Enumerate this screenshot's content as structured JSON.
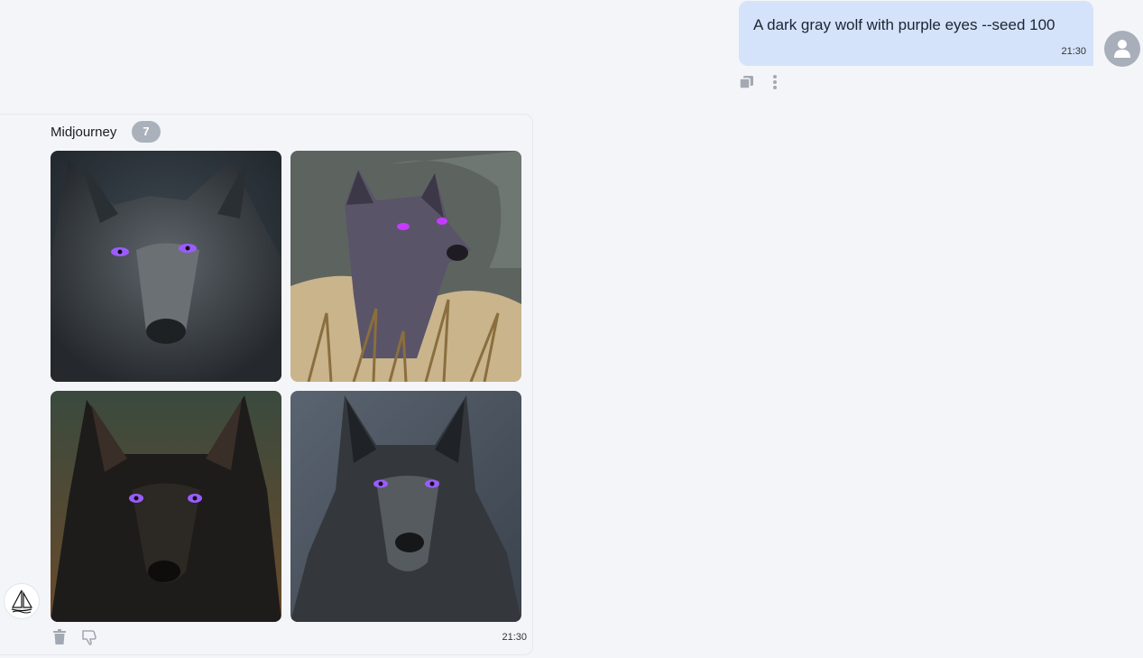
{
  "user_message": {
    "text": "A dark gray wolf with purple eyes --seed 100",
    "time": "21:30",
    "actions": [
      "copy-icon",
      "more-vertical-icon"
    ]
  },
  "bot_message": {
    "author": "Midjourney",
    "badge": "7",
    "time": "21:30",
    "images": [
      {
        "description": "photo-wolf-dark-gray-purple-eyes"
      },
      {
        "description": "illustration-wolf-grass-purple-eyes"
      },
      {
        "description": "photo-wolf-black-brown-background"
      },
      {
        "description": "photo-wolf-gray-front-facing"
      }
    ],
    "actions": [
      "trash-icon",
      "thumbs-down-icon"
    ]
  },
  "colors": {
    "background": "#f4f5f8",
    "user_bubble": "#d4e3fa",
    "badge": "#aab1bb",
    "wolf_eye": "#9b5cff"
  }
}
